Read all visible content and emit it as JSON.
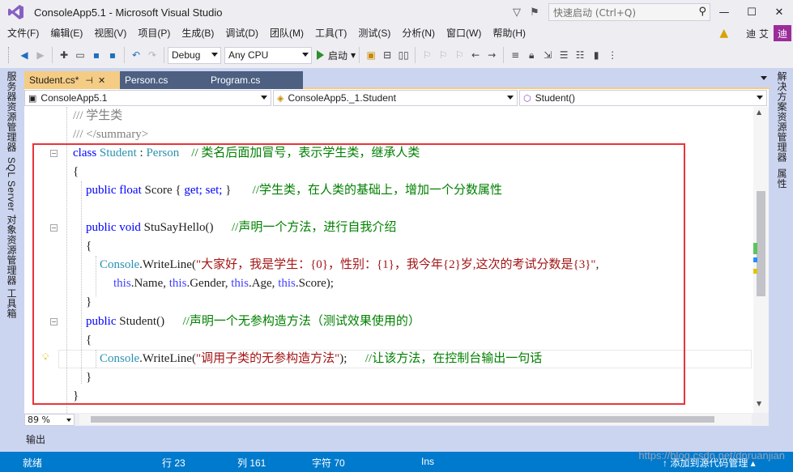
{
  "window": {
    "title": "ConsoleApp5.1 - Microsoft Visual Studio",
    "quick_launch_placeholder": "快速启动 (Ctrl+Q)",
    "minimize": "—",
    "maximize": "☐",
    "close": "✕"
  },
  "menu": {
    "items": [
      "文件(F)",
      "编辑(E)",
      "视图(V)",
      "项目(P)",
      "生成(B)",
      "调试(D)",
      "团队(M)",
      "工具(T)",
      "测试(S)",
      "分析(N)",
      "窗口(W)",
      "帮助(H)"
    ],
    "user_name": "迪 艾",
    "user_badge": "迪"
  },
  "toolbar": {
    "config": "Debug",
    "platform": "Any CPU",
    "start_label": "启动"
  },
  "left_tabs": [
    "服务器资源管理器",
    "SQL Server 对象资源管理器",
    "工具箱"
  ],
  "right_tabs": [
    "解决方案资源管理器",
    "属性"
  ],
  "doc_tabs": [
    {
      "label": "Student.cs*",
      "pin": "⊣",
      "close": "✕"
    },
    {
      "label": "Person.cs"
    },
    {
      "label": "Program.cs"
    }
  ],
  "nav": {
    "project": "ConsoleApp5.1",
    "class": "ConsoleApp5._1.Student",
    "member": "Student()"
  },
  "code": {
    "l1_doc": "/// 学生类",
    "l2_doc": "/// </summary>",
    "l3_class": "class",
    "l3_name": "Student",
    "l3_colon": " : ",
    "l3_base": "Person",
    "l3_comment": "// 类名后面加冒号，表示学生类，继承人类",
    "l4": "{",
    "l5_public": "public",
    "l5_float": "float",
    "l5_rest": " Score { ",
    "l5_get": "get;",
    "l5_set": "set;",
    "l5_close": " }",
    "l5_comment": "//学生类，在人类的基础上，增加一个分数属性",
    "l7_public": "public",
    "l7_void": "void",
    "l7_rest": " StuSayHello()",
    "l7_comment": "//声明一个方法，进行自我介绍",
    "l8": "{",
    "l9_console": "Console",
    "l9_call": ".WriteLine(",
    "l9_str": "\"大家好，我是学生：{0}，性别：{1}，我今年{2}岁,这次的考试分数是{3}\"",
    "l9_end": ",",
    "l10_this1": "this",
    "l10_name": ".Name, ",
    "l10_this2": "this",
    "l10_gender": ".Gender, ",
    "l10_this3": "this",
    "l10_age": ".Age, ",
    "l10_this4": "this",
    "l10_score": ".Score);",
    "l11": "}",
    "l12_public": "public",
    "l12_rest": " Student()",
    "l12_comment": "//声明一个无参构造方法（测试效果使用的）",
    "l13": "{",
    "l14_console": "Console",
    "l14_call": ".WriteLine(",
    "l14_str": "\"调用子类的无参构造方法\"",
    "l14_end": ");",
    "l14_comment": "//让该方法，在控制台输出一句话",
    "l15": "}",
    "l16": "}"
  },
  "editor": {
    "zoom": "89 %"
  },
  "output": {
    "label": "输出"
  },
  "status": {
    "ready": "就绪",
    "row": "行 23",
    "col": "列 161",
    "char": "字符 70",
    "ins": "Ins",
    "source_control": "↑ 添加到源代码管理 ▴"
  },
  "watermark": "https://blog.csdn.net/dnruanjian",
  "colors": {
    "keyword": "#0000ff",
    "type": "#2b91af",
    "comment": "#008000",
    "string": "#a31515",
    "highlight_box": "#e8343a",
    "statusbar": "#007acc"
  }
}
